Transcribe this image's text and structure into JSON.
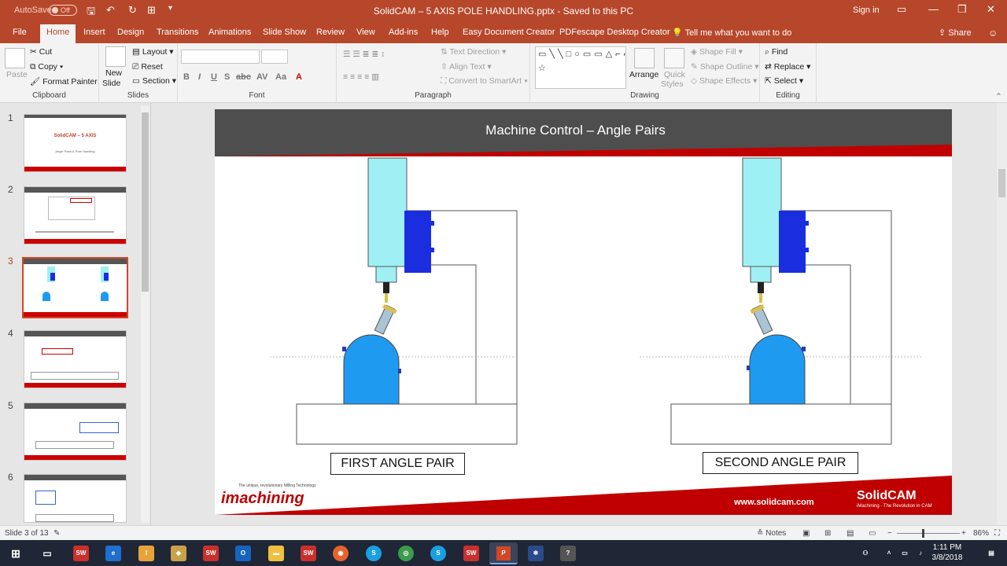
{
  "window": {
    "autosave_label": "AutoSave",
    "autosave_state": "Off",
    "title": "SolidCAM – 5 AXIS POLE HANDLING.pptx  -  Saved to this PC",
    "signin": "Sign in"
  },
  "tabs": [
    "File",
    "Home",
    "Insert",
    "Design",
    "Transitions",
    "Animations",
    "Slide Show",
    "Review",
    "View",
    "Add-ins",
    "Help",
    "Easy Document Creator",
    "PDFescape Desktop Creator"
  ],
  "tell_me": "Tell me what you want to do",
  "share": "Share",
  "ribbon": {
    "clipboard": {
      "paste": "Paste",
      "cut": "Cut",
      "copy": "Copy",
      "format_painter": "Format Painter",
      "label": "Clipboard"
    },
    "slides": {
      "new_slide_1": "New",
      "new_slide_2": "Slide",
      "layout": "Layout",
      "reset": "Reset",
      "section": "Section",
      "label": "Slides"
    },
    "font": {
      "label": "Font",
      "buttons": [
        "B",
        "I",
        "U",
        "S",
        "abc",
        "AV",
        "Aa",
        "A"
      ]
    },
    "paragraph": {
      "text_direction": "Text Direction",
      "align_text": "Align Text",
      "convert_smartart": "Convert to SmartArt",
      "label": "Paragraph"
    },
    "drawing": {
      "arrange": "Arrange",
      "quick_styles_1": "Quick",
      "quick_styles_2": "Styles",
      "shape_fill": "Shape Fill",
      "shape_outline": "Shape Outline",
      "shape_effects": "Shape Effects",
      "label": "Drawing",
      "shapes": "▭╲╲□○▭▭△⌐⌐⇨⇩◇◟◟⌒{}☆"
    },
    "editing": {
      "find": "Find",
      "replace": "Replace",
      "select": "Select",
      "label": "Editing"
    }
  },
  "thumbnails": [
    {
      "num": "1",
      "title": "SolidCAM – 5 AXIS",
      "subtitle": "Angle Pairs & Pole Handling"
    },
    {
      "num": "2",
      "title": "",
      "subtitle": ""
    },
    {
      "num": "3",
      "title": "",
      "subtitle": ""
    },
    {
      "num": "4",
      "title": "",
      "subtitle": ""
    },
    {
      "num": "5",
      "title": "",
      "subtitle": ""
    },
    {
      "num": "6",
      "title": "",
      "subtitle": ""
    }
  ],
  "slide": {
    "title": "Machine Control – Angle Pairs",
    "label_first": "FIRST ANGLE PAIR",
    "label_second": "SECOND ANGLE PAIR",
    "footer_website": "www.solidcam.com",
    "footer_brand": "SolidCAM",
    "footer_brand_tag": "iMachining - The Revolution in CAM",
    "footer_imachining": "imachining",
    "footer_imachining_tag": "The unique, revolutionary Milling Technology"
  },
  "status": {
    "slide_counter": "Slide 3 of 13",
    "notes": "Notes",
    "zoom": "86%"
  },
  "taskbar": {
    "time": "1:11 PM",
    "date": "3/8/2018"
  },
  "colors": {
    "accent": "#b7472a",
    "slide_header": "#4e4e4e",
    "slide_red": "#c00000",
    "spindle_cyan": "#9ef0f4",
    "head_blue": "#1a2ee0",
    "table_blue": "#1e9bf0"
  }
}
